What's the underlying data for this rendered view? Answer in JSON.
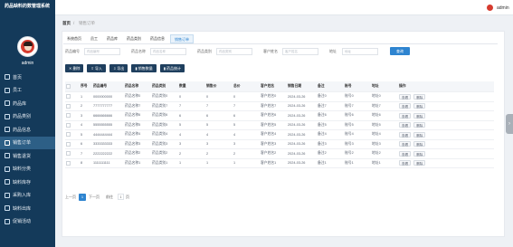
{
  "app": {
    "title": "药品缺料的数管理系统"
  },
  "user": {
    "name": "admin"
  },
  "sidebar": {
    "items": [
      {
        "label": "首页",
        "icon": "home-icon"
      },
      {
        "label": "员工",
        "icon": "user-icon"
      },
      {
        "label": "药品库",
        "icon": "box-icon"
      },
      {
        "label": "药品类别",
        "icon": "grid-icon"
      },
      {
        "label": "药品信息",
        "icon": "info-icon"
      },
      {
        "label": "销售订单",
        "icon": "order-icon",
        "active": true
      },
      {
        "label": "销售退货",
        "icon": "return-icon"
      },
      {
        "label": "缺料分类",
        "icon": "list-icon"
      },
      {
        "label": "缺料库存",
        "icon": "stock-icon"
      },
      {
        "label": "采购入库",
        "icon": "inbound-icon"
      },
      {
        "label": "缺料出库",
        "icon": "outbound-icon"
      },
      {
        "label": "促销活动",
        "icon": "promo-icon"
      }
    ]
  },
  "breadcrumb": {
    "home": "首页",
    "current": "销售订单"
  },
  "tabs": [
    {
      "label": "系统首页"
    },
    {
      "label": "员工"
    },
    {
      "label": "药品库"
    },
    {
      "label": "药品类别"
    },
    {
      "label": "药品信息"
    },
    {
      "label": "销售订单",
      "active": true
    }
  ],
  "search": {
    "fields": [
      {
        "label": "药品编号",
        "placeholder": "药品编号"
      },
      {
        "label": "药品名称",
        "placeholder": "药品名称"
      },
      {
        "label": "药品类别",
        "placeholder": "药品类别"
      },
      {
        "label": "客户姓名",
        "placeholder": "客户姓名"
      },
      {
        "label": "地址",
        "placeholder": "地址"
      }
    ],
    "button": "查询"
  },
  "toolbar": {
    "buttons": [
      {
        "label": "删除"
      },
      {
        "label": "导入"
      },
      {
        "label": "导出"
      },
      {
        "label": "销售数量"
      },
      {
        "label": "药品统计"
      }
    ]
  },
  "table": {
    "headers": [
      "",
      "序号",
      "药品编号",
      "药品名称",
      "药品类别",
      "数量",
      "销售价",
      "总价",
      "客户姓名",
      "销售日期",
      "备注",
      "账号",
      "地址",
      "操作"
    ],
    "rows": [
      {
        "no": "1",
        "code": "0000000000",
        "name": "药品名称0",
        "category": "药品类别0",
        "qty": "0",
        "price": "0",
        "total": "0",
        "customer": "客户姓名0",
        "date": "2024-03-26",
        "remark": "备注0",
        "account": "账号0",
        "address": "地址0"
      },
      {
        "no": "2",
        "code": "7777777777",
        "name": "药品名称7",
        "category": "药品类别7",
        "qty": "7",
        "price": "7",
        "total": "7",
        "customer": "客户姓名7",
        "date": "2024-03-26",
        "remark": "备注7",
        "account": "账号7",
        "address": "地址7"
      },
      {
        "no": "3",
        "code": "6666666666",
        "name": "药品名称6",
        "category": "药品类别6",
        "qty": "6",
        "price": "6",
        "total": "6",
        "customer": "客户姓名6",
        "date": "2024-03-26",
        "remark": "备注6",
        "account": "账号6",
        "address": "地址6"
      },
      {
        "no": "4",
        "code": "5555555555",
        "name": "药品名称5",
        "category": "药品类别5",
        "qty": "5",
        "price": "5",
        "total": "5",
        "customer": "客户姓名5",
        "date": "2024-03-26",
        "remark": "备注5",
        "account": "账号5",
        "address": "地址5"
      },
      {
        "no": "5",
        "code": "4444444444",
        "name": "药品名称4",
        "category": "药品类别4",
        "qty": "4",
        "price": "4",
        "total": "4",
        "customer": "客户姓名4",
        "date": "2024-03-26",
        "remark": "备注4",
        "account": "账号4",
        "address": "地址4"
      },
      {
        "no": "6",
        "code": "3333333333",
        "name": "药品名称3",
        "category": "药品类别3",
        "qty": "3",
        "price": "3",
        "total": "3",
        "customer": "客户姓名3",
        "date": "2024-03-26",
        "remark": "备注3",
        "account": "账号3",
        "address": "地址3"
      },
      {
        "no": "7",
        "code": "2222222222",
        "name": "药品名称2",
        "category": "药品类别2",
        "qty": "2",
        "price": "2",
        "total": "2",
        "customer": "客户姓名2",
        "date": "2024-03-26",
        "remark": "备注2",
        "account": "账号2",
        "address": "地址2"
      },
      {
        "no": "8",
        "code": "1111111111",
        "name": "药品名称1",
        "category": "药品类别1",
        "qty": "1",
        "price": "1",
        "total": "1",
        "customer": "客户姓名1",
        "date": "2024-03-26",
        "remark": "备注1",
        "account": "账号1",
        "address": "地址1"
      }
    ],
    "actions": {
      "view": "查看",
      "delete": "删除"
    }
  },
  "pagination": {
    "prev": "上一页",
    "current": "1",
    "next": "下一页",
    "goto": "前往",
    "page_value": "1",
    "page_unit": "页"
  }
}
